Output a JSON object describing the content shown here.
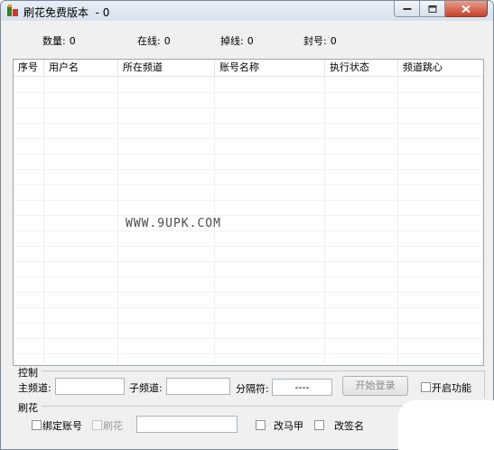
{
  "window": {
    "title": "刷花免费版本  - 0",
    "controls": {
      "minimize": "minimize-icon",
      "maximize": "maximize-icon",
      "close": "close-icon"
    }
  },
  "stats": {
    "count_label": "数量:",
    "count_value": "0",
    "online_label": "在线:",
    "online_value": "0",
    "dropped_label": "掉线:",
    "dropped_value": "0",
    "banned_label": "封号:",
    "banned_value": "0"
  },
  "table": {
    "columns": [
      "序号",
      "用户名",
      "所在频道",
      "账号名称",
      "执行状态",
      "频道跳心"
    ],
    "rows": []
  },
  "watermark": "WWW.9UPK.COM",
  "control_group": {
    "title": "控制",
    "main_channel_label": "主频道:",
    "main_channel_value": "",
    "sub_channel_label": "子频道:",
    "sub_channel_value": "",
    "separator_label": "分隔符:",
    "separator_value": "----",
    "start_login_button": "开始登录",
    "enable_feature_label": "开启功能"
  },
  "flower_group": {
    "title": "刷花",
    "bind_account_label": "绑定账号",
    "flower_label": "刷花",
    "text_value": "",
    "change_vest_label": "改马甲",
    "change_signature_label": "改签名"
  }
}
